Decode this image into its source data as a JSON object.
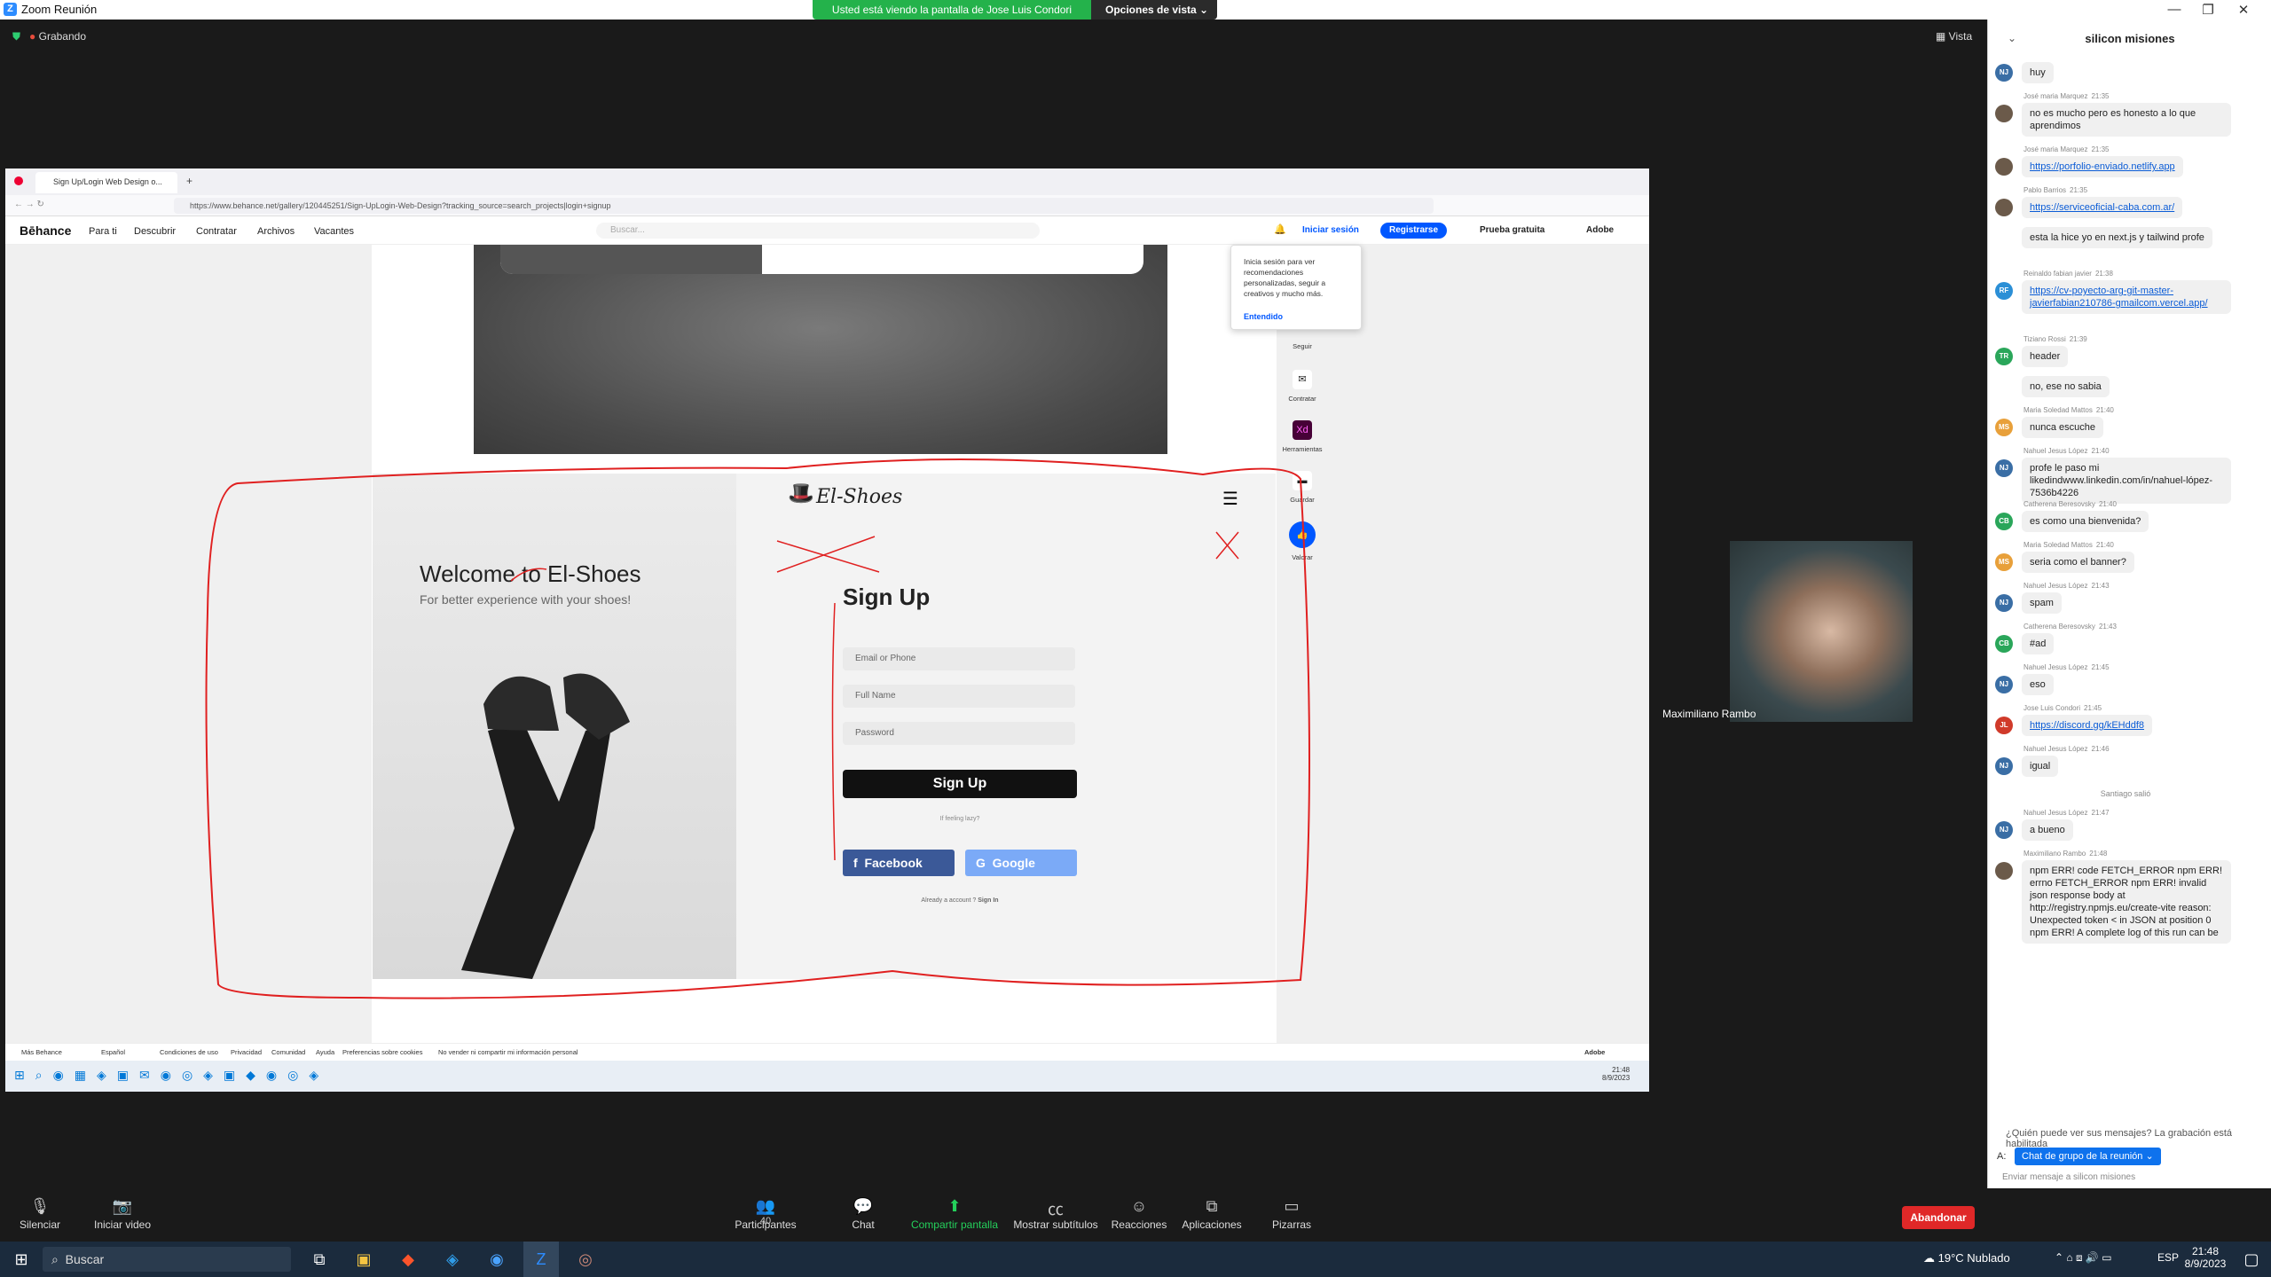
{
  "window": {
    "title": "Zoom Reunión"
  },
  "share_banner": {
    "message": "Usted está viendo la pantalla de Jose Luis Condori",
    "options": "Opciones de vista"
  },
  "meeting": {
    "recording": "Grabando",
    "view": "Vista"
  },
  "browser": {
    "tab": "Sign Up/Login Web Design o...",
    "url": "https://www.behance.net/gallery/120445251/Sign-UpLogin-Web-Design?tracking_source=search_projects|login+signup"
  },
  "behance": {
    "logo": "Bēhance",
    "nav": [
      "Para ti",
      "Descubrir",
      "Contratar",
      "Archivos",
      "Vacantes"
    ],
    "search_placeholder": "Buscar...",
    "login": "Iniciar sesión",
    "register": "Registrarse",
    "trial": "Prueba gratuita",
    "adobe": "Adobe"
  },
  "tooltip": {
    "text": "Inicia sesión para ver recomendaciones personalizadas, seguir a creativos y mucho más.",
    "ok": "Entendido"
  },
  "sidebar": [
    "Seguir",
    "Contratar",
    "Herramientas",
    "Guardar",
    "Valorar"
  ],
  "design": {
    "brand": "El-Shoes",
    "welcome": "Welcome to El-Shoes",
    "subtitle": "For better experience with your shoes!",
    "signup_title": "Sign Up",
    "email": "Email or Phone",
    "fullname": "Full Name",
    "password": "Password",
    "button": "Sign Up",
    "lazy": "If feeling lazy?",
    "facebook": "Facebook",
    "google": "Google",
    "already": "Already a account ?",
    "signin": "Sign In"
  },
  "footer": {
    "more": "Más Behance",
    "lang": "Español",
    "links": [
      "Condiciones de uso",
      "Privacidad",
      "Comunidad",
      "Ayuda",
      "Preferencias sobre cookies",
      "No vender ni compartir mi información personal"
    ],
    "adobe": "Adobe"
  },
  "inner_clock": {
    "time": "21:48",
    "date": "8/9/2023"
  },
  "video": {
    "name": "Maximiliano Rambo"
  },
  "chat": {
    "title": "silicon misiones",
    "messages": [
      {
        "sender": "",
        "time": "",
        "text": "huy",
        "avatar": "NJ"
      },
      {
        "sender": "José maria Marquez",
        "time": "21:35",
        "text": "no es mucho pero es honesto a lo que aprendimos",
        "avatar": ""
      },
      {
        "sender": "José maria Marquez",
        "time": "21:35",
        "text": "https://porfolio-enviado.netlify.app",
        "avatar": "",
        "link": true
      },
      {
        "sender": "Pablo Barrios",
        "time": "21:35",
        "text": "https://serviceoficial-caba.com.ar/",
        "avatar": "",
        "link": true
      },
      {
        "sender": "",
        "time": "",
        "text": "esta la hice yo en next.js y tailwind profe",
        "avatar": ""
      },
      {
        "sender": "Reinaldo fabian javier",
        "time": "21:38",
        "text": "https://cv-poyecto-arg-git-master-javierfabian210786-gmailcom.vercel.app/",
        "avatar": "RF",
        "link": true
      },
      {
        "sender": "Tiziano Rossi",
        "time": "21:39",
        "text": "header",
        "avatar": "TR"
      },
      {
        "sender": "",
        "time": "",
        "text": "no, ese no sabia",
        "avatar": ""
      },
      {
        "sender": "Maria Soledad Mattos",
        "time": "21:40",
        "text": "nunca escuche",
        "avatar": "MS"
      },
      {
        "sender": "Nahuel Jesus López",
        "time": "21:40",
        "text": "profe le paso mi likedindwww.linkedin.com/in/nahuel-lópez-7536b4226",
        "avatar": "NJ"
      },
      {
        "sender": "Catherena Beresovsky",
        "time": "21:40",
        "text": "es como una bienvenida?",
        "avatar": "CB"
      },
      {
        "sender": "Maria Soledad Mattos",
        "time": "21:40",
        "text": "seria como el banner?",
        "avatar": "MS"
      },
      {
        "sender": "Nahuel Jesus López",
        "time": "21:43",
        "text": "spam",
        "avatar": "NJ"
      },
      {
        "sender": "Catherena Beresovsky",
        "time": "21:43",
        "text": "#ad",
        "avatar": "CB"
      },
      {
        "sender": "Nahuel Jesus López",
        "time": "21:45",
        "text": "eso",
        "avatar": "NJ"
      },
      {
        "sender": "Jose Luis Condori",
        "time": "21:45",
        "text": "https://discord.gg/kEHddf8",
        "avatar": "JL",
        "link": true
      },
      {
        "sender": "Nahuel Jesus López",
        "time": "21:46",
        "text": "igual",
        "avatar": "NJ"
      },
      {
        "sender": "",
        "time": "",
        "text": "Santiago salió",
        "avatar": "",
        "system": true
      },
      {
        "sender": "Nahuel Jesus López",
        "time": "21:47",
        "text": "a bueno",
        "avatar": "NJ"
      },
      {
        "sender": "Maximiliano Rambo",
        "time": "21:48",
        "text": "npm ERR! code FETCH_ERROR npm ERR! errno FETCH_ERROR npm ERR! invalid json response body at http://registry.npmjs.eu/create-vite reason: Unexpected token < in JSON at position 0  npm ERR! A complete log of this run can be",
        "avatar": ""
      }
    ],
    "who": "¿Quién puede ver sus mensajes? La grabación está habilitada",
    "to_label": "A:",
    "to": "Chat de grupo de la reunión",
    "placeholder": "Enviar mensaje a silicon misiones"
  },
  "toolbar": {
    "mute": "Silenciar",
    "video": "Iniciar video",
    "participants": "Participantes",
    "count": "40",
    "chat": "Chat",
    "share": "Compartir pantalla",
    "cc": "Mostrar subtítulos",
    "react": "Reacciones",
    "apps": "Aplicaciones",
    "boards": "Pizarras",
    "leave": "Abandonar"
  },
  "taskbar": {
    "search": "Buscar",
    "weather": "19°C Nublado",
    "lang": "ESP",
    "time": "21:48",
    "date": "8/9/2023"
  },
  "colors": {
    "green": "#24b24b",
    "zoom_blue": "#2d8cff",
    "leave_red": "#e02828",
    "behance_blue": "#0057ff"
  }
}
